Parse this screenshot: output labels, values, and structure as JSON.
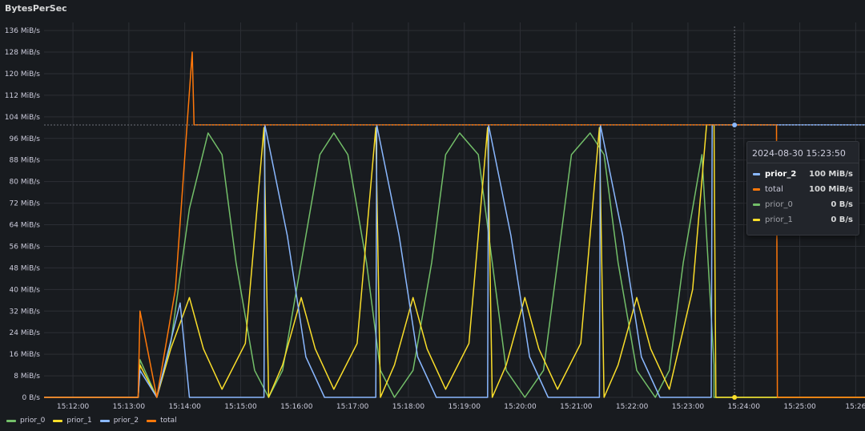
{
  "panel": {
    "title": "BytesPerSec"
  },
  "colors": {
    "prior_0": "#73bf69",
    "prior_1": "#fade2a",
    "prior_2": "#8ab8ff",
    "total": "#ff780a",
    "grid": "#2c2f35",
    "crosshair": "#6e7079"
  },
  "legend": [
    {
      "name": "prior_0",
      "color": "#73bf69"
    },
    {
      "name": "prior_1",
      "color": "#fade2a"
    },
    {
      "name": "prior_2",
      "color": "#8ab8ff"
    },
    {
      "name": "total",
      "color": "#ff780a"
    }
  ],
  "tooltip": {
    "time": "2024-08-30 15:23:50",
    "rows": [
      {
        "name": "prior_2",
        "value": "100 MiB/s",
        "color": "#8ab8ff",
        "state": "active"
      },
      {
        "name": "total",
        "value": "100 MiB/s",
        "color": "#ff780a",
        "state": "normal"
      },
      {
        "name": "prior_0",
        "value": "0 B/s",
        "color": "#73bf69",
        "state": "dim"
      },
      {
        "name": "prior_1",
        "value": "0 B/s",
        "color": "#fade2a",
        "state": "dim"
      }
    ]
  },
  "chart_data": {
    "type": "line",
    "title": "BytesPerSec",
    "x_unit": "minutes",
    "xlim": [
      "15:11:29",
      "15:26:10"
    ],
    "ylim": [
      0,
      139
    ],
    "y_ticks": [
      "0 B/s",
      "8 MiB/s",
      "16 MiB/s",
      "24 MiB/s",
      "32 MiB/s",
      "40 MiB/s",
      "48 MiB/s",
      "56 MiB/s",
      "64 MiB/s",
      "72 MiB/s",
      "80 MiB/s",
      "88 MiB/s",
      "96 MiB/s",
      "104 MiB/s",
      "112 MiB/s",
      "120 MiB/s",
      "128 MiB/s",
      "136 MiB/s"
    ],
    "y_tick_values": [
      0,
      8,
      16,
      24,
      32,
      40,
      48,
      56,
      64,
      72,
      80,
      88,
      96,
      104,
      112,
      120,
      128,
      136
    ],
    "x_ticks": [
      "15:12:00",
      "15:13:00",
      "15:14:00",
      "15:15:00",
      "15:16:00",
      "15:17:00",
      "15:18:00",
      "15:19:00",
      "15:20:00",
      "15:21:00",
      "15:22:00",
      "15:23:00",
      "15:24:00",
      "15:25:00",
      "15:26"
    ],
    "x_tick_values": [
      "15:12:00",
      "15:13:00",
      "15:14:00",
      "15:15:00",
      "15:16:00",
      "15:17:00",
      "15:18:00",
      "15:19:00",
      "15:20:00",
      "15:21:00",
      "15:22:00",
      "15:23:00",
      "15:24:00",
      "15:25:00",
      "15:26:00"
    ],
    "grid": true,
    "legend_position": "bottom-left",
    "crosshair": {
      "x": "15:23:50",
      "y": 101
    },
    "series": [
      {
        "name": "prior_0",
        "color": "#73bf69",
        "x": [
          "15:11:29",
          "15:13:10",
          "15:13:12",
          "15:13:30",
          "15:13:45",
          "15:14:05",
          "15:14:25",
          "15:14:40",
          "15:14:55",
          "15:15:15",
          "15:15:30",
          "15:15:45",
          "15:16:05",
          "15:16:25",
          "15:16:40",
          "15:16:55",
          "15:17:15",
          "15:17:30",
          "15:17:45",
          "15:18:05",
          "15:18:25",
          "15:18:40",
          "15:18:55",
          "15:19:15",
          "15:19:30",
          "15:19:45",
          "15:20:05",
          "15:20:25",
          "15:20:40",
          "15:20:55",
          "15:21:15",
          "15:21:30",
          "15:21:45",
          "15:22:05",
          "15:22:25",
          "15:22:40",
          "15:22:55",
          "15:23:15",
          "15:23:28",
          "15:23:28",
          "15:26:10"
        ],
        "y": [
          0,
          0,
          14,
          0,
          20,
          70,
          98,
          90,
          50,
          10,
          0,
          10,
          50,
          90,
          98,
          90,
          50,
          10,
          0,
          10,
          50,
          90,
          98,
          90,
          50,
          10,
          0,
          10,
          50,
          90,
          98,
          90,
          50,
          10,
          0,
          10,
          50,
          90,
          12,
          0,
          0
        ]
      },
      {
        "name": "prior_1",
        "color": "#fade2a",
        "x": [
          "15:11:29",
          "15:13:10",
          "15:13:12",
          "15:13:30",
          "15:13:45",
          "15:14:05",
          "15:14:20",
          "15:14:40",
          "15:15:05",
          "15:15:25",
          "15:15:30",
          "15:15:45",
          "15:16:05",
          "15:16:20",
          "15:16:40",
          "15:17:05",
          "15:17:25",
          "15:17:30",
          "15:17:45",
          "15:18:05",
          "15:18:20",
          "15:18:40",
          "15:19:05",
          "15:19:25",
          "15:19:30",
          "15:19:45",
          "15:20:05",
          "15:20:20",
          "15:20:40",
          "15:21:05",
          "15:21:25",
          "15:21:30",
          "15:21:45",
          "15:22:05",
          "15:22:20",
          "15:22:40",
          "15:23:05",
          "15:23:20",
          "15:23:28",
          "15:23:30",
          "15:26:10"
        ],
        "y": [
          0,
          0,
          12,
          0,
          18,
          37,
          18,
          3,
          20,
          100,
          0,
          12,
          37,
          18,
          3,
          20,
          100,
          0,
          12,
          37,
          18,
          3,
          20,
          100,
          0,
          12,
          37,
          18,
          3,
          20,
          100,
          0,
          12,
          37,
          18,
          3,
          40,
          101,
          101,
          0,
          0
        ]
      },
      {
        "name": "prior_2",
        "color": "#8ab8ff",
        "x": [
          "15:11:29",
          "15:13:10",
          "15:13:12",
          "15:13:30",
          "15:13:55",
          "15:14:05",
          "15:14:40",
          "15:15:25",
          "15:15:26",
          "15:15:50",
          "15:16:10",
          "15:16:30",
          "15:17:25",
          "15:17:26",
          "15:17:50",
          "15:18:10",
          "15:18:30",
          "15:19:25",
          "15:19:26",
          "15:19:50",
          "15:20:10",
          "15:20:30",
          "15:21:25",
          "15:21:26",
          "15:21:50",
          "15:22:10",
          "15:22:30",
          "15:23:25",
          "15:23:26",
          "15:23:50",
          "15:26:10"
        ],
        "y": [
          0,
          0,
          10,
          0,
          35,
          0,
          0,
          0,
          101,
          60,
          15,
          0,
          0,
          101,
          60,
          15,
          0,
          0,
          101,
          60,
          15,
          0,
          0,
          101,
          60,
          15,
          0,
          0,
          101,
          101,
          101
        ]
      },
      {
        "name": "total",
        "color": "#ff780a",
        "x": [
          "15:11:29",
          "15:13:10",
          "15:13:12",
          "15:13:30",
          "15:13:50",
          "15:14:08",
          "15:14:10",
          "15:14:15",
          "15:24:35",
          "15:24:36",
          "15:26:10"
        ],
        "y": [
          0,
          0,
          32,
          0,
          40,
          128,
          101,
          101,
          101,
          0,
          0
        ]
      }
    ]
  }
}
